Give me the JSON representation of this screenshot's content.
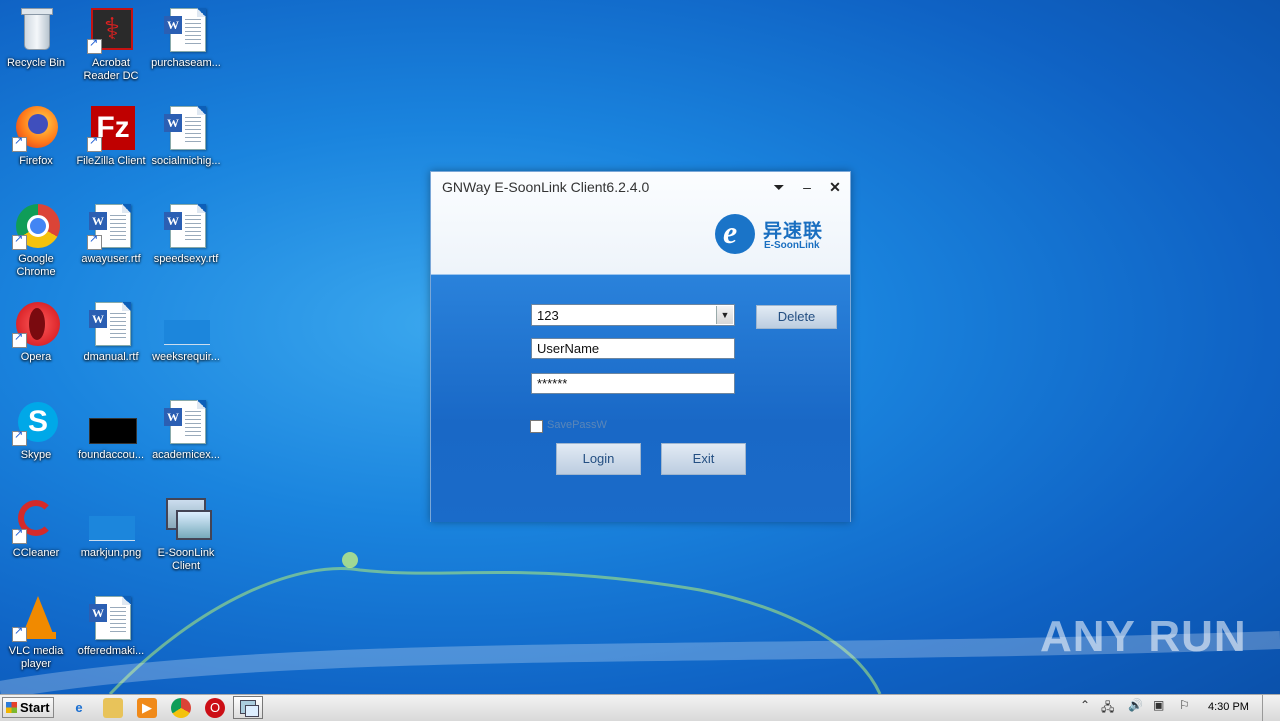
{
  "desktop": {
    "icons": [
      {
        "label": "Recycle Bin",
        "icon": "recycle-bin-icon"
      },
      {
        "label": "Acrobat Reader DC",
        "icon": "acrobat-reader-icon"
      },
      {
        "label": "purchaseam...",
        "icon": "word-document-icon"
      },
      {
        "label": "Firefox",
        "icon": "firefox-icon"
      },
      {
        "label": "FileZilla Client",
        "icon": "filezilla-icon"
      },
      {
        "label": "socialmichig...",
        "icon": "word-document-icon"
      },
      {
        "label": "Google Chrome",
        "icon": "chrome-icon"
      },
      {
        "label": "awayuser.rtf",
        "icon": "word-document-icon"
      },
      {
        "label": "speedsexy.rtf",
        "icon": "word-document-icon"
      },
      {
        "label": "Opera",
        "icon": "opera-icon"
      },
      {
        "label": "dmanual.rtf",
        "icon": "word-document-icon"
      },
      {
        "label": "weeksrequir...",
        "icon": "image-file-icon"
      },
      {
        "label": "Skype",
        "icon": "skype-icon"
      },
      {
        "label": "foundaccou...",
        "icon": "image-file-icon"
      },
      {
        "label": "academicex...",
        "icon": "word-document-icon"
      },
      {
        "label": "CCleaner",
        "icon": "ccleaner-icon"
      },
      {
        "label": "markjun.png",
        "icon": "image-file-icon"
      },
      {
        "label": "E-SoonLink Client",
        "icon": "esoonlink-client-icon"
      },
      {
        "label": "VLC media player",
        "icon": "vlc-icon"
      },
      {
        "label": "offeredmaki...",
        "icon": "word-document-icon"
      }
    ]
  },
  "dialog": {
    "title": "GNWay E-SoonLink Client6.2.4.0",
    "logo_cn": "异速联",
    "logo_en": "E-SoonLink",
    "server_value": "123",
    "delete_label": "Delete",
    "username_value": "UserName",
    "password_value": "******",
    "save_password_label": "SavePassW",
    "login_label": "Login",
    "exit_label": "Exit"
  },
  "watermark": "ANY RUN",
  "taskbar": {
    "start_label": "Start",
    "clock": "4:30 PM"
  }
}
